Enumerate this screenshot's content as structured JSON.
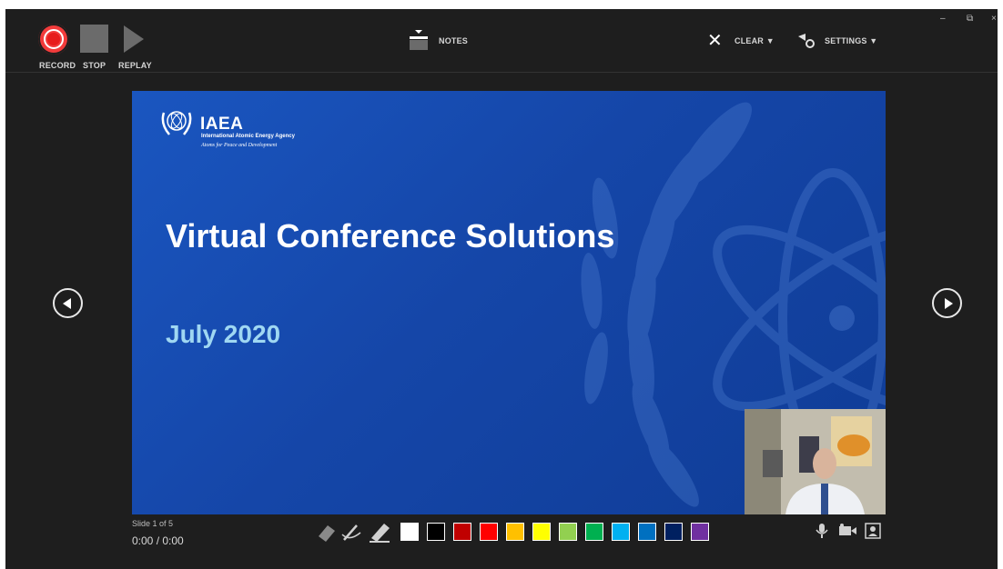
{
  "toolbar": {
    "record_label": "RECORD",
    "stop_label": "STOP",
    "replay_label": "REPLAY",
    "notes_label": "NOTES",
    "clear_label": "CLEAR ▼",
    "settings_label": "SETTINGS ▼",
    "icons": [
      "record-icon",
      "stop-icon",
      "replay-icon",
      "notes-icon",
      "clear-icon",
      "settings-icon"
    ]
  },
  "window_controls": {
    "minimize": "–",
    "restore": "⧉",
    "close": "×"
  },
  "slide": {
    "logo_title": "IAEA",
    "logo_subtitle": "International Atomic Energy Agency",
    "logo_tagline": "Atoms for Peace and Development",
    "title": "Virtual Conference Solutions",
    "subtitle": "July 2020"
  },
  "status": {
    "slide_counter": "Slide 1 of 5",
    "timer": "0:00 / 0:00"
  },
  "ink_tools": [
    "eraser-icon",
    "pen-icon",
    "highlighter-icon"
  ],
  "colors": {
    "background": "#1e1e1e",
    "slide_blue": "#1a56c0",
    "record_red": "#f23b3b",
    "subtitle_blue": "#9fd7f2",
    "palette": [
      "#ffffff",
      "#000000",
      "#c00000",
      "#ff0000",
      "#ffc000",
      "#ffff00",
      "#92d050",
      "#00b050",
      "#00b0f0",
      "#0070c0",
      "#002060",
      "#7030a0"
    ]
  },
  "media_icons": [
    "microphone-icon",
    "camera-icon",
    "camera-preview-icon"
  ]
}
